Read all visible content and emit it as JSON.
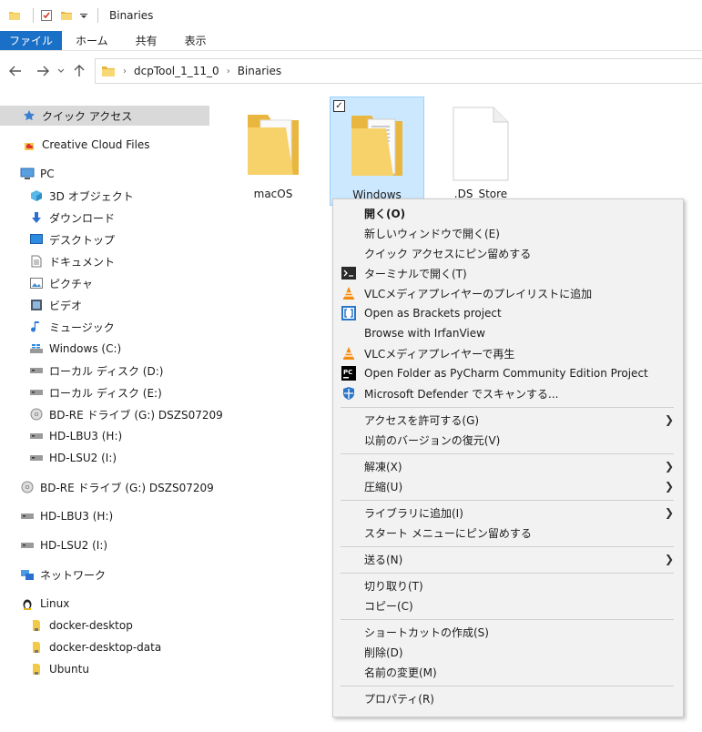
{
  "window": {
    "title": "Binaries",
    "quick_access_icons": [
      "folder-icon",
      "properties-check-icon",
      "new-folder-icon",
      "dropdown-arrow-icon"
    ]
  },
  "ribbon": {
    "tabs": [
      {
        "label": "ファイル",
        "name": "tab-file"
      },
      {
        "label": "ホーム",
        "name": "tab-home"
      },
      {
        "label": "共有",
        "name": "tab-share"
      },
      {
        "label": "表示",
        "name": "tab-view"
      }
    ]
  },
  "address": {
    "crumbs": [
      "dcpTool_1_11_0",
      "Binaries"
    ]
  },
  "nav": {
    "items": [
      {
        "label": "クイック アクセス",
        "icon": "star-icon"
      },
      {
        "label": "Creative Cloud Files",
        "icon": "creative-cloud-icon"
      },
      {
        "label": "PC",
        "icon": "pc-icon"
      },
      {
        "label": "3D オブジェクト",
        "icon": "3d-objects-icon"
      },
      {
        "label": "ダウンロード",
        "icon": "download-icon"
      },
      {
        "label": "デスクトップ",
        "icon": "desktop-icon"
      },
      {
        "label": "ドキュメント",
        "icon": "documents-icon"
      },
      {
        "label": "ピクチャ",
        "icon": "pictures-icon"
      },
      {
        "label": "ビデオ",
        "icon": "videos-icon"
      },
      {
        "label": "ミュージック",
        "icon": "music-icon"
      },
      {
        "label": "Windows (C:)",
        "icon": "windows-drive-icon"
      },
      {
        "label": "ローカル ディスク (D:)",
        "icon": "drive-icon"
      },
      {
        "label": "ローカル ディスク (E:)",
        "icon": "drive-icon"
      },
      {
        "label": "BD-RE ドライブ (G:) DSZS07209",
        "icon": "disc-icon"
      },
      {
        "label": "HD-LBU3 (H:)",
        "icon": "drive-icon"
      },
      {
        "label": "HD-LSU2 (I:)",
        "icon": "drive-icon"
      },
      {
        "label": "BD-RE ドライブ (G:) DSZS07209",
        "icon": "disc-icon"
      },
      {
        "label": "HD-LBU3 (H:)",
        "icon": "drive-icon"
      },
      {
        "label": "HD-LSU2 (I:)",
        "icon": "drive-icon"
      },
      {
        "label": "ネットワーク",
        "icon": "network-icon"
      },
      {
        "label": "Linux",
        "icon": "linux-icon"
      },
      {
        "label": "docker-desktop",
        "icon": "folder-icon"
      },
      {
        "label": "docker-desktop-data",
        "icon": "folder-icon"
      },
      {
        "label": "Ubuntu",
        "icon": "folder-icon"
      }
    ]
  },
  "files": [
    {
      "label": "macOS",
      "icon": "folder-icon"
    },
    {
      "label": "Windows",
      "icon": "folder-icon",
      "checkbox": "✓"
    },
    {
      "label": ".DS_Store",
      "icon": "file-icon"
    }
  ],
  "context_menu": {
    "items": [
      {
        "label": "開く(O)",
        "icon": "",
        "bold": true
      },
      {
        "label": "新しいウィンドウで開く(E)",
        "icon": ""
      },
      {
        "label": "クイック アクセスにピン留めする",
        "icon": ""
      },
      {
        "label": "ターミナルで開く(T)",
        "icon": "terminal-icon"
      },
      {
        "label": "VLCメディアプレイヤーのプレイリストに追加",
        "icon": "vlc-icon"
      },
      {
        "label": "Open as Brackets project",
        "icon": "brackets-icon"
      },
      {
        "label": "Browse with IrfanView",
        "icon": ""
      },
      {
        "label": "VLCメディアプレイヤーで再生",
        "icon": "vlc-icon"
      },
      {
        "label": "Open Folder as PyCharm Community Edition Project",
        "icon": "pycharm-icon"
      },
      {
        "label": "Microsoft Defender でスキャンする...",
        "icon": "defender-icon"
      },
      {
        "label": "アクセスを許可する(G)",
        "icon": "",
        "arrow": "❯"
      },
      {
        "label": "以前のバージョンの復元(V)",
        "icon": ""
      },
      {
        "label": "解凍(X)",
        "icon": "",
        "arrow": "❯"
      },
      {
        "label": "圧縮(U)",
        "icon": "",
        "arrow": "❯"
      },
      {
        "label": "ライブラリに追加(I)",
        "icon": "",
        "arrow": "❯"
      },
      {
        "label": "スタート メニューにピン留めする",
        "icon": ""
      },
      {
        "label": "送る(N)",
        "icon": "",
        "arrow": "❯"
      },
      {
        "label": "切り取り(T)",
        "icon": ""
      },
      {
        "label": "コピー(C)",
        "icon": ""
      },
      {
        "label": "ショートカットの作成(S)",
        "icon": ""
      },
      {
        "label": "削除(D)",
        "icon": ""
      },
      {
        "label": "名前の変更(M)",
        "icon": ""
      },
      {
        "label": "プロパティ(R)",
        "icon": ""
      }
    ]
  }
}
